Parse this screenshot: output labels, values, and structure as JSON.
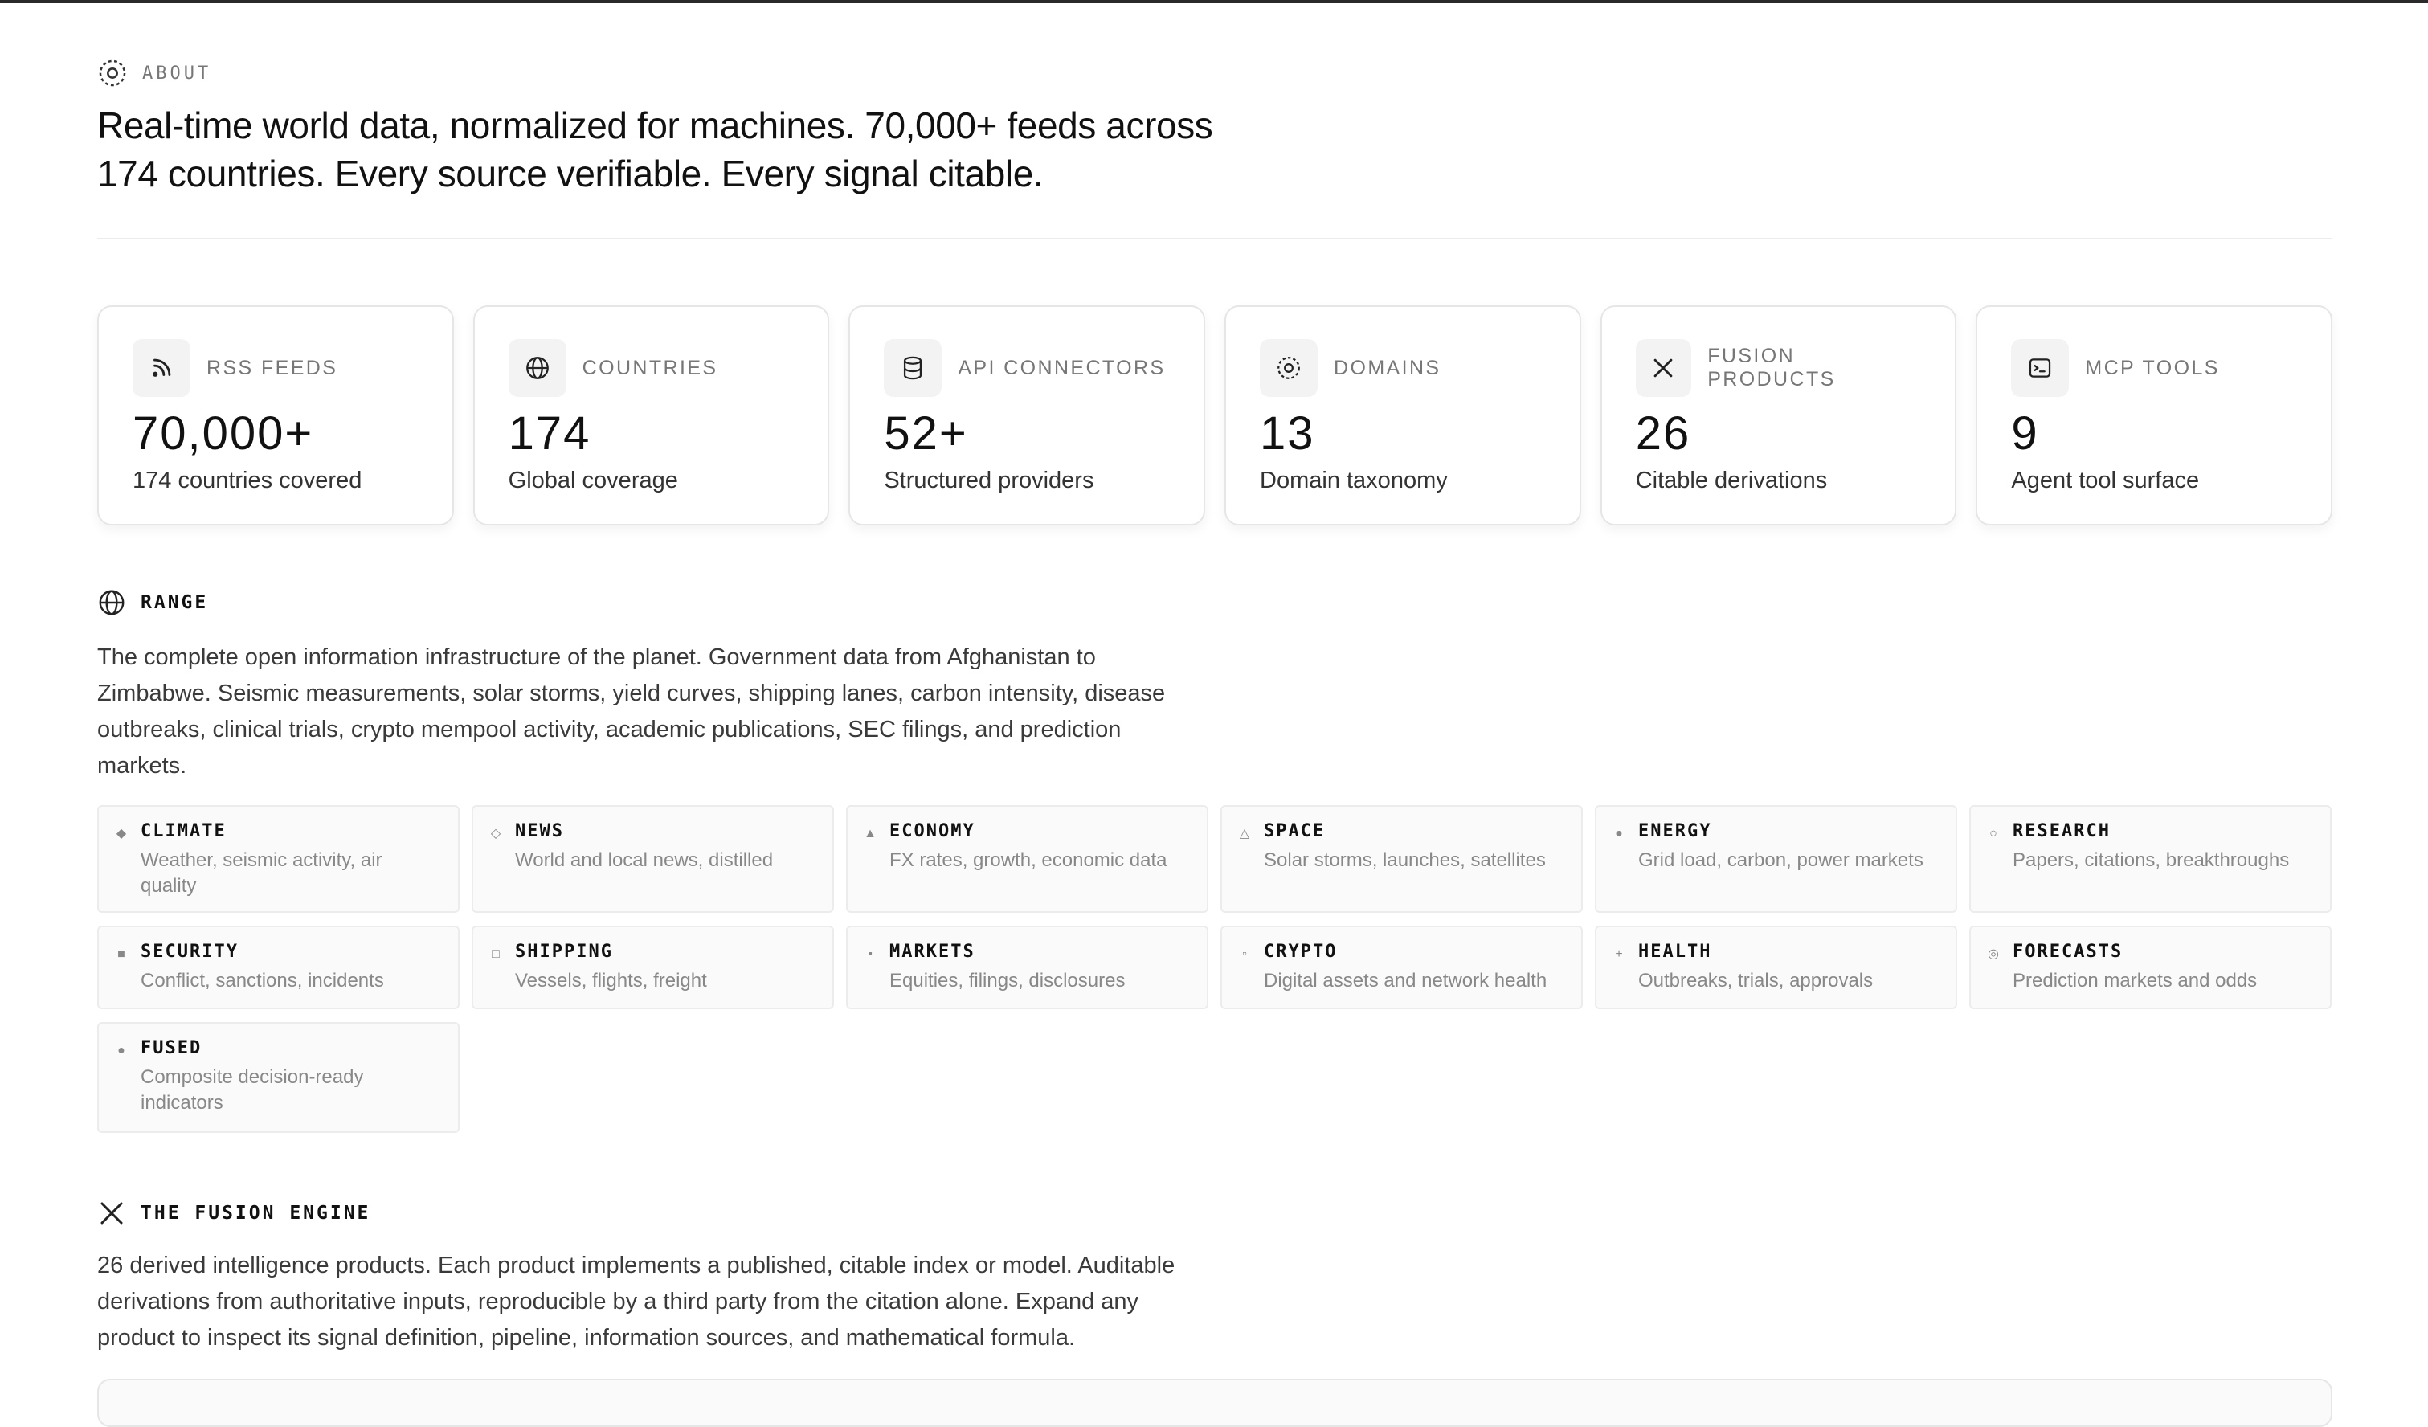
{
  "about": {
    "label": "ABOUT",
    "headline_line1": "Real-time world data, normalized for machines. 70,000+ feeds across",
    "headline_line2": "174 countries. Every source verifiable. Every signal citable."
  },
  "stats": [
    {
      "icon": "rss-icon",
      "label": "RSS FEEDS",
      "value": "70,000+",
      "sub": "174 countries covered"
    },
    {
      "icon": "globe-icon",
      "label": "COUNTRIES",
      "value": "174",
      "sub": "Global coverage"
    },
    {
      "icon": "database-icon",
      "label": "API CONNECTORS",
      "value": "52+",
      "sub": "Structured providers"
    },
    {
      "icon": "target-icon",
      "label": "DOMAINS",
      "value": "13",
      "sub": "Domain taxonomy"
    },
    {
      "icon": "fusion-x-icon",
      "label": "FUSION PRODUCTS",
      "value": "26",
      "sub": "Citable derivations"
    },
    {
      "icon": "terminal-icon",
      "label": "MCP TOOLS",
      "value": "9",
      "sub": "Agent tool surface"
    }
  ],
  "range": {
    "title": "RANGE",
    "body_line1": "The complete open information infrastructure of the planet. Government data from Afghanistan to",
    "body_line2": "Zimbabwe. Seismic measurements, solar storms, yield curves, shipping lanes, carbon intensity, disease",
    "body_line3": "outbreaks, clinical trials, crypto mempool activity, academic publications, SEC filings, and prediction",
    "body_line4": "markets."
  },
  "domains": [
    {
      "glyph": "◆",
      "name": "CLIMATE",
      "desc": "Weather, seismic activity, air quality"
    },
    {
      "glyph": "◇",
      "name": "NEWS",
      "desc": "World and local news, distilled"
    },
    {
      "glyph": "▲",
      "name": "ECONOMY",
      "desc": "FX rates, growth, economic data"
    },
    {
      "glyph": "△",
      "name": "SPACE",
      "desc": "Solar storms, launches, satellites"
    },
    {
      "glyph": "●",
      "name": "ENERGY",
      "desc": "Grid load, carbon, power markets"
    },
    {
      "glyph": "○",
      "name": "RESEARCH",
      "desc": "Papers, citations, breakthroughs"
    },
    {
      "glyph": "■",
      "name": "SECURITY",
      "desc": "Conflict, sanctions, incidents"
    },
    {
      "glyph": "□",
      "name": "SHIPPING",
      "desc": "Vessels, flights, freight"
    },
    {
      "glyph": "▪",
      "name": "MARKETS",
      "desc": "Equities, filings, disclosures"
    },
    {
      "glyph": "▫",
      "name": "CRYPTO",
      "desc": "Digital assets and network health"
    },
    {
      "glyph": "+",
      "name": "HEALTH",
      "desc": "Outbreaks, trials, approvals"
    },
    {
      "glyph": "◎",
      "name": "FORECASTS",
      "desc": "Prediction markets and odds"
    },
    {
      "glyph": "●",
      "name": "FUSED",
      "desc": "Composite decision-ready indicators"
    }
  ],
  "fusion": {
    "title": "THE FUSION ENGINE",
    "body_line1": "26 derived intelligence products. Each product implements a published, citable index or model. Auditable",
    "body_line2": "derivations from authoritative inputs, reproducible by a third party from the citation alone. Expand any",
    "body_line3": "product to inspect its signal definition, pipeline, information sources, and mathematical formula."
  }
}
